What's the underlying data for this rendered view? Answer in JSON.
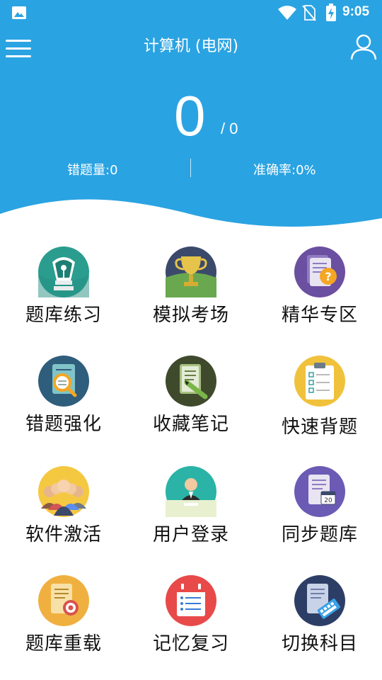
{
  "status": {
    "time": "9:05"
  },
  "header": {
    "title": "计算机 (电网)",
    "score": "0",
    "total": "/ 0",
    "wrong_label": "错题量:0",
    "accuracy_label": "准确率:0%"
  },
  "colors": {
    "primary": "#2aa3e2"
  },
  "grid": [
    {
      "label": "题库练习",
      "icon": "pen-nib-icon"
    },
    {
      "label": "模拟考场",
      "icon": "trophy-icon"
    },
    {
      "label": "精华专区",
      "icon": "document-question-icon"
    },
    {
      "label": "错题强化",
      "icon": "magnifier-document-icon"
    },
    {
      "label": "收藏笔记",
      "icon": "notebook-pencil-icon"
    },
    {
      "label": "快速背题",
      "icon": "clipboard-checklist-icon"
    },
    {
      "label": "软件激活",
      "icon": "people-group-icon"
    },
    {
      "label": "用户登录",
      "icon": "user-desk-icon"
    },
    {
      "label": "同步题库",
      "icon": "document-calendar-icon"
    },
    {
      "label": "题库重载",
      "icon": "document-target-icon"
    },
    {
      "label": "记忆复习",
      "icon": "calendar-list-icon"
    },
    {
      "label": "切换科目",
      "icon": "document-keyboard-icon"
    }
  ]
}
